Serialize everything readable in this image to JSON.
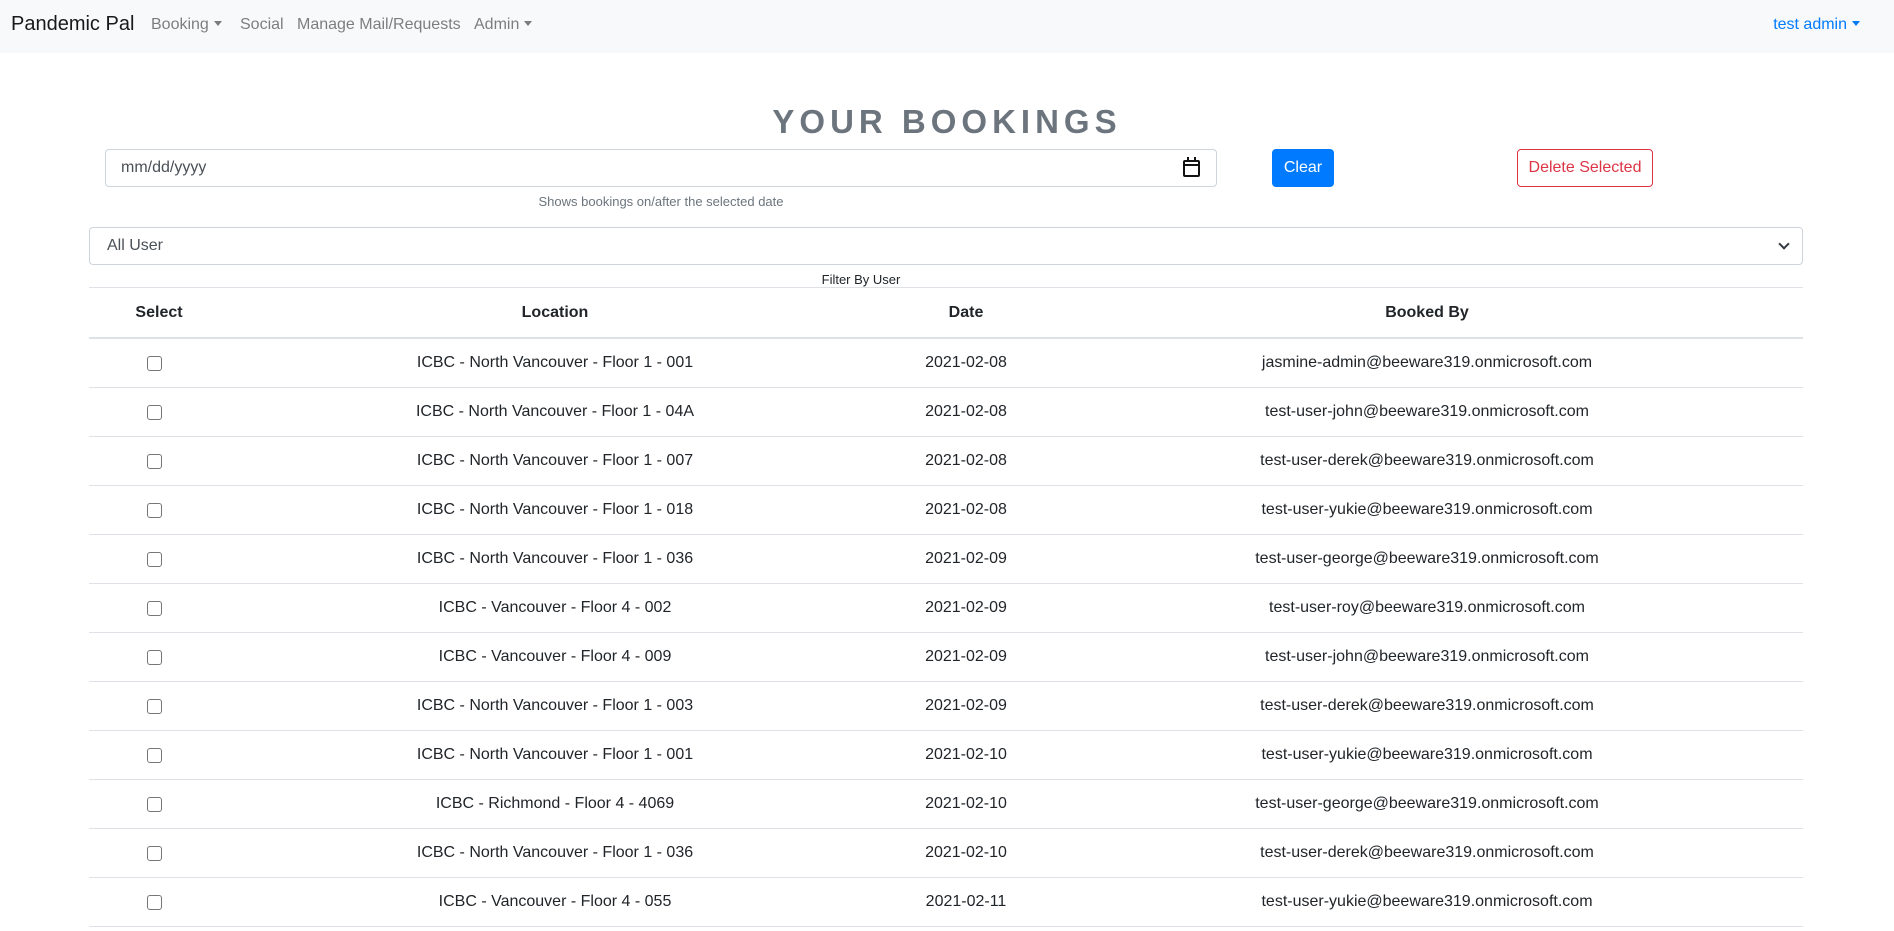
{
  "nav": {
    "brand": "Pandemic Pal",
    "items": [
      "Booking",
      "Social",
      "Manage Mail/Requests",
      "Admin"
    ],
    "user": "test admin"
  },
  "page": {
    "title": "YOUR BOOKINGS",
    "date_placeholder": "mm/dd/yyyy",
    "date_hint": "Shows bookings on/after the selected date",
    "clear_label": "Clear",
    "delete_label": "Delete Selected",
    "user_filter_value": "All User",
    "user_filter_hint": "Filter By User"
  },
  "table": {
    "headers": [
      "Select",
      "Location",
      "Date",
      "Booked By"
    ],
    "rows": [
      {
        "location": "ICBC - North Vancouver - Floor 1 - 001",
        "date": "2021-02-08",
        "booked_by": "jasmine-admin@beeware319.onmicrosoft.com"
      },
      {
        "location": "ICBC - North Vancouver - Floor 1 - 04A",
        "date": "2021-02-08",
        "booked_by": "test-user-john@beeware319.onmicrosoft.com"
      },
      {
        "location": "ICBC - North Vancouver - Floor 1 - 007",
        "date": "2021-02-08",
        "booked_by": "test-user-derek@beeware319.onmicrosoft.com"
      },
      {
        "location": "ICBC - North Vancouver - Floor 1 - 018",
        "date": "2021-02-08",
        "booked_by": "test-user-yukie@beeware319.onmicrosoft.com"
      },
      {
        "location": "ICBC - North Vancouver - Floor 1 - 036",
        "date": "2021-02-09",
        "booked_by": "test-user-george@beeware319.onmicrosoft.com"
      },
      {
        "location": "ICBC - Vancouver - Floor 4 - 002",
        "date": "2021-02-09",
        "booked_by": "test-user-roy@beeware319.onmicrosoft.com"
      },
      {
        "location": "ICBC - Vancouver - Floor 4 - 009",
        "date": "2021-02-09",
        "booked_by": "test-user-john@beeware319.onmicrosoft.com"
      },
      {
        "location": "ICBC - North Vancouver - Floor 1 - 003",
        "date": "2021-02-09",
        "booked_by": "test-user-derek@beeware319.onmicrosoft.com"
      },
      {
        "location": "ICBC - North Vancouver - Floor 1 - 001",
        "date": "2021-02-10",
        "booked_by": "test-user-yukie@beeware319.onmicrosoft.com"
      },
      {
        "location": "ICBC - Richmond - Floor 4 - 4069",
        "date": "2021-02-10",
        "booked_by": "test-user-george@beeware319.onmicrosoft.com"
      },
      {
        "location": "ICBC - North Vancouver - Floor 1 - 036",
        "date": "2021-02-10",
        "booked_by": "test-user-derek@beeware319.onmicrosoft.com"
      },
      {
        "location": "ICBC - Vancouver - Floor 4 - 055",
        "date": "2021-02-11",
        "booked_by": "test-user-yukie@beeware319.onmicrosoft.com"
      }
    ]
  }
}
